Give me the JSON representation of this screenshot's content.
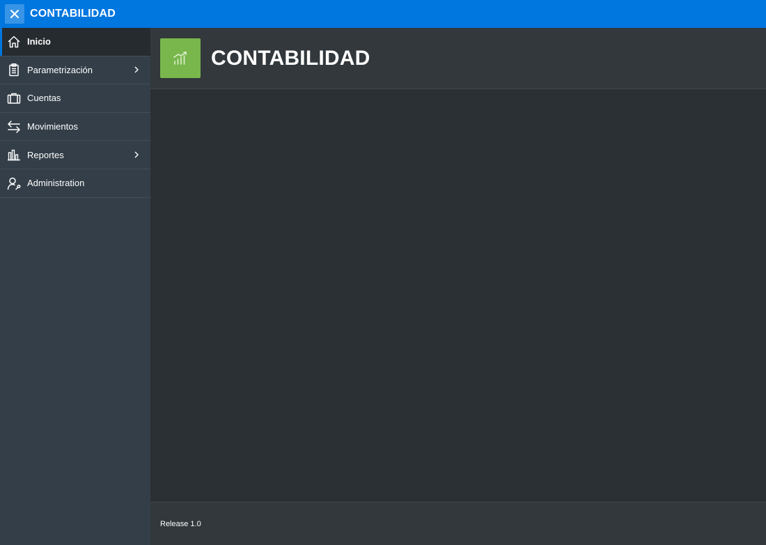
{
  "topbar": {
    "title": "CONTABILIDAD",
    "color": "#0076df"
  },
  "sidebar": {
    "items": [
      {
        "label": "Inicio",
        "icon": "home-icon",
        "active": true,
        "has_submenu": false
      },
      {
        "label": "Parametrización",
        "icon": "clipboard-icon",
        "active": false,
        "has_submenu": true
      },
      {
        "label": "Cuentas",
        "icon": "briefcase-icon",
        "active": false,
        "has_submenu": false
      },
      {
        "label": "Movimientos",
        "icon": "transfer-arrows-icon",
        "active": false,
        "has_submenu": false
      },
      {
        "label": "Reportes",
        "icon": "bar-chart-icon",
        "active": false,
        "has_submenu": true
      },
      {
        "label": "Administration",
        "icon": "user-wrench-icon",
        "active": false,
        "has_submenu": false
      }
    ]
  },
  "header": {
    "title": "CONTABILIDAD",
    "icon": "growth-chart-icon",
    "icon_color": "#79b74d"
  },
  "footer": {
    "release": "Release 1.0"
  }
}
